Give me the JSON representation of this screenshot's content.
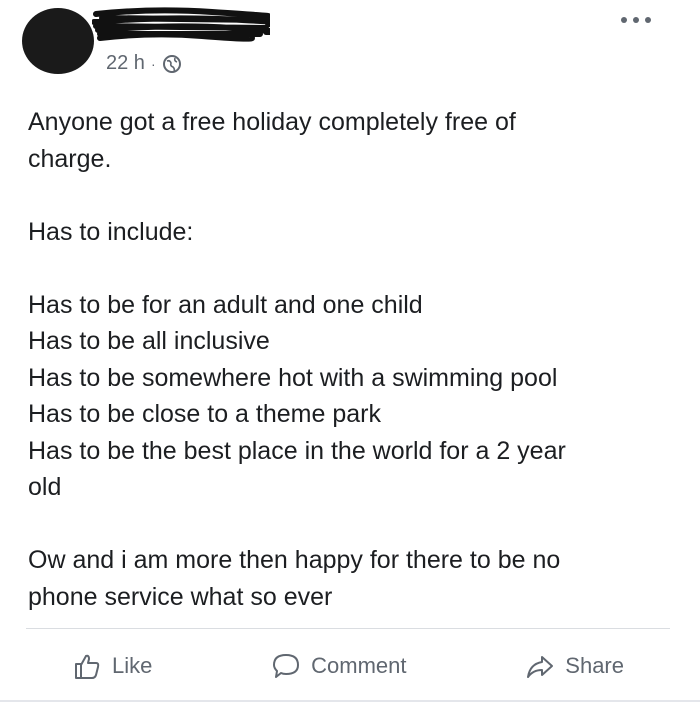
{
  "post": {
    "timestamp": "22 h",
    "separator": "·",
    "privacy_icon": "globe-icon",
    "more_icon": "ellipsis-icon",
    "lines": [
      "Anyone got a free holiday completely free of",
      "charge.",
      "",
      "Has to include:",
      "",
      "Has to be for an adult and one child",
      "Has to be all inclusive",
      "Has to be somewhere hot with a swimming pool",
      "Has to be close to a theme park",
      "Has to be the best place in the world for a 2 year",
      "old",
      "",
      "Ow and i am more then happy for there to be no",
      "phone service what so ever"
    ]
  },
  "actions": {
    "like_label": "Like",
    "comment_label": "Comment",
    "share_label": "Share",
    "like_icon": "thumbs-up-icon",
    "comment_icon": "speech-bubble-icon",
    "share_icon": "share-arrow-icon"
  },
  "colors": {
    "text": "#1c1e21",
    "secondary": "#606770",
    "divider": "#dadde1"
  }
}
